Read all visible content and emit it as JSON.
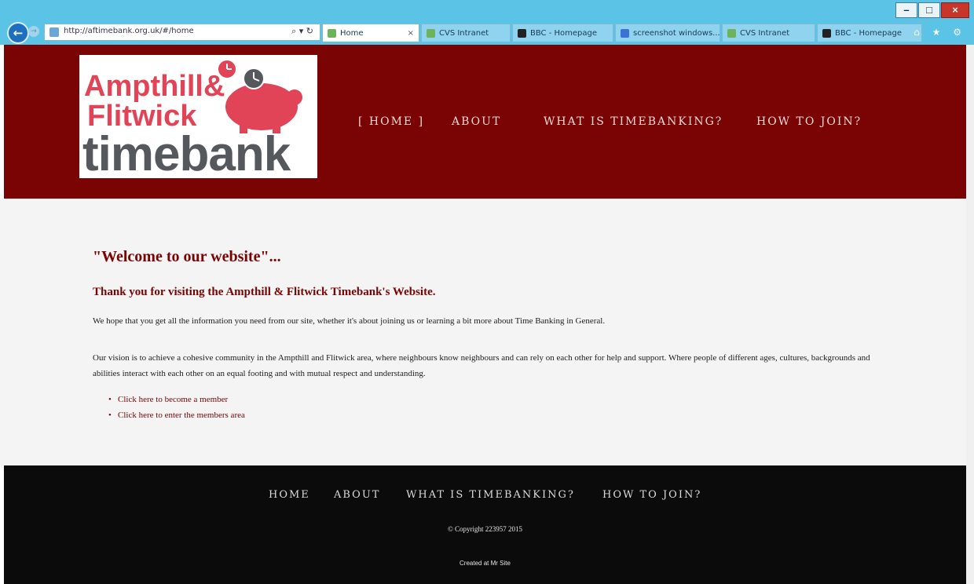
{
  "browser": {
    "url": "http://aftimebank.org.uk/#/home",
    "address_tools": "⌕ ▾ ↻",
    "tabs": [
      {
        "label": "Home",
        "icon": "green-globe-icon",
        "close": "×"
      },
      {
        "label": "CVS Intranet",
        "icon": "green-globe-icon"
      },
      {
        "label": "BBC - Homepage",
        "icon": "bbc-icon"
      },
      {
        "label": "screenshot windows...",
        "icon": "blue-page-icon"
      },
      {
        "label": "CVS Intranet",
        "icon": "green-globe-icon"
      },
      {
        "label": "BBC - Homepage",
        "icon": "bbc-icon"
      }
    ],
    "window_controls": {
      "minimize": "–",
      "restore": "□",
      "close": "×"
    },
    "back": "←",
    "forward": "→",
    "toolbar_icons": "⌂ ★ ⚙"
  },
  "header": {
    "logo": {
      "line1": "Ampthill&",
      "line2": "Flitwick",
      "line3": "timebank"
    },
    "nav": [
      "[ HOME ]",
      "ABOUT",
      "WHAT IS TIMEBANKING?",
      "HOW TO JOIN?"
    ],
    "colors": {
      "header_bg": "#7a0303",
      "logo_pink": "#e14357",
      "logo_grey": "#55595d"
    }
  },
  "content": {
    "heading": "\"Welcome to our website\"...",
    "subheading": "Thank you for visiting the Ampthill & Flitwick Timebank's Website.",
    "intro": "We hope that you get all the information you need from our site, whether it's about joining us or learning a bit more about Time Banking in General.",
    "vision": "Our vision is to achieve a cohesive community in the Ampthill and Flitwick area, where neighbours know neighbours and can rely on each other for help and support. Where people of different ages, cultures, backgrounds and abilities interact with each other on an equal footing and with mutual respect and understanding.",
    "links": [
      "Click here to become a member",
      "Click here to enter the members area"
    ],
    "bullet": "•"
  },
  "footer": {
    "nav": [
      "HOME",
      "ABOUT",
      "WHAT IS TIMEBANKING?",
      "HOW TO JOIN?"
    ],
    "copyright": "© Copyright 223957 2015",
    "credit": "Created at Mr Site"
  }
}
